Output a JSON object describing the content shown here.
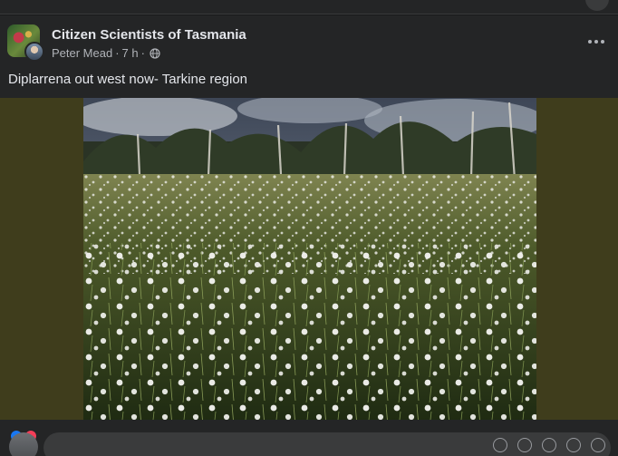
{
  "post": {
    "group_name": "Citizen Scientists of Tasmania",
    "author": "Peter Mead",
    "time": "7 h",
    "separator": "·",
    "text": "Diplarrena out west now- Tarkine region"
  },
  "icons": {
    "more": "more-options-icon",
    "audience": "globe-icon",
    "reactions": [
      "like-icon",
      "love-icon"
    ]
  },
  "colors": {
    "background": "#242526",
    "text": "#e4e6eb",
    "secondary_text": "#b0b3b8",
    "media_backdrop": "#3f3d1c",
    "like": "#1877f2",
    "love": "#f33e58"
  }
}
